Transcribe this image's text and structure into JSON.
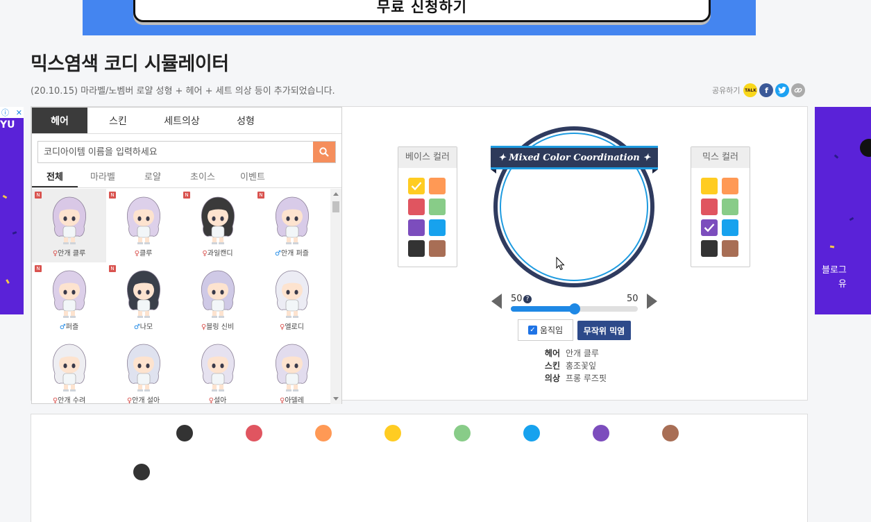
{
  "banner": {
    "text": "무료 신청하기"
  },
  "page": {
    "title": "믹스염색 코디 시뮬레이터",
    "notice": "(20.10.15) 마라벨/노벰버 로얄 성형 + 헤어 + 세트 의상 등이 추가되었습니다."
  },
  "share": {
    "label": "공유하기",
    "icons": [
      "kakaotalk-icon",
      "facebook-icon",
      "twitter-icon",
      "link-icon"
    ],
    "kakao_text": "TALK"
  },
  "ads": {
    "left_text": "YU",
    "right_line1": "블로그",
    "right_line2": "유"
  },
  "item_panel": {
    "tabs": [
      "헤어",
      "스킨",
      "세트의상",
      "성형"
    ],
    "active_tab": "헤어",
    "search_placeholder": "코디아이템 이름을 입력하세요",
    "subtabs": [
      "전체",
      "마라벨",
      "로얄",
      "초이스",
      "이벤트"
    ],
    "active_subtab": "전체",
    "new_badge": "N",
    "items": [
      {
        "name": "안개 클루",
        "sex": "♀",
        "new": true,
        "hair": "#d9c8e6",
        "selected": true
      },
      {
        "name": "클루",
        "sex": "♀",
        "new": true,
        "hair": "#ddd0ea"
      },
      {
        "name": "과일캔디",
        "sex": "♀",
        "new": true,
        "hair": "#3a3a3a"
      },
      {
        "name": "안개 퍼즐",
        "sex": "♂",
        "new": true,
        "hair": "#d8cbe8"
      },
      {
        "name": "퍼즐",
        "sex": "♂",
        "new": true,
        "hair": "#dccfe9"
      },
      {
        "name": "나모",
        "sex": "♂",
        "new": true,
        "hair": "#3a3f4a"
      },
      {
        "name": "블링 신비",
        "sex": "♀",
        "new": false,
        "hair": "#cfc9e6"
      },
      {
        "name": "엘로디",
        "sex": "♀",
        "new": false,
        "hair": "#ececf4"
      },
      {
        "name": "안개 수려",
        "sex": "♀",
        "new": false,
        "hair": "#eeeef2"
      },
      {
        "name": "안개 설아",
        "sex": "♀",
        "new": false,
        "hair": "#dfe2ef"
      },
      {
        "name": "설아",
        "sex": "♀",
        "new": false,
        "hair": "#e6e2f0"
      },
      {
        "name": "아델레",
        "sex": "♀",
        "new": false,
        "hair": "#e2dcee"
      }
    ]
  },
  "base_color": {
    "title": "베이스 컬러",
    "selected": "yellow",
    "swatches": [
      {
        "name": "yellow",
        "hex": "#ffcc22"
      },
      {
        "name": "orange",
        "hex": "#ff9955"
      },
      {
        "name": "red",
        "hex": "#e05560"
      },
      {
        "name": "green",
        "hex": "#88cc88"
      },
      {
        "name": "purple",
        "hex": "#7c4dbd"
      },
      {
        "name": "blue",
        "hex": "#17a2ee"
      },
      {
        "name": "black",
        "hex": "#333333"
      },
      {
        "name": "brown",
        "hex": "#a86e55"
      }
    ]
  },
  "mix_color": {
    "title": "믹스 컬러",
    "selected": "purple",
    "swatches": [
      {
        "name": "yellow",
        "hex": "#ffcc22"
      },
      {
        "name": "orange",
        "hex": "#ff9955"
      },
      {
        "name": "red",
        "hex": "#e05560"
      },
      {
        "name": "green",
        "hex": "#88cc88"
      },
      {
        "name": "purple",
        "hex": "#7c4dbd"
      },
      {
        "name": "blue",
        "hex": "#17a2ee"
      },
      {
        "name": "black",
        "hex": "#333333"
      },
      {
        "name": "brown",
        "hex": "#a86e55"
      }
    ]
  },
  "preview": {
    "ribbon": "✦ Mixed Color Coordination ✦"
  },
  "mix_ratio": {
    "base": "50",
    "mix": "50",
    "help": "?",
    "slider_fraction": 0.5
  },
  "controls": {
    "move_label": "움직임",
    "move_checked": true,
    "random_label": "무작위 믹염"
  },
  "info": [
    {
      "key": "헤어",
      "value": "안개 클루"
    },
    {
      "key": "스킨",
      "value": "홍조꽃잎"
    },
    {
      "key": "의상",
      "value": "프롱 루즈핏"
    }
  ],
  "bottom_colors": {
    "row1": [
      "#333333",
      "#e05560",
      "#ff9955",
      "#ffcc22",
      "#88cc88",
      "#17a2ee",
      "#7c4dbd",
      "#a86e55"
    ],
    "row2": [
      "#333333"
    ]
  }
}
